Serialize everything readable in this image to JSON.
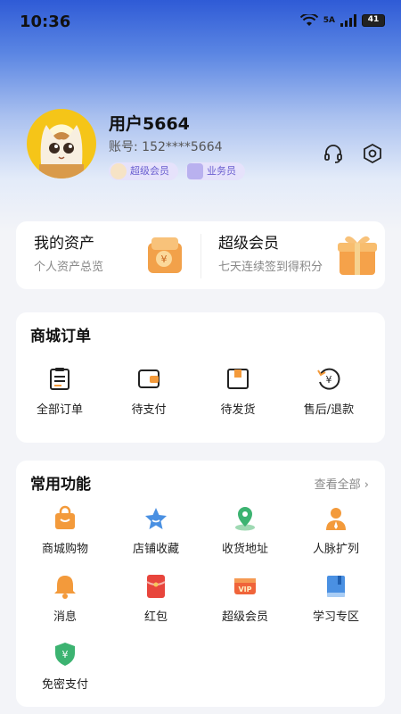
{
  "status_bar": {
    "time": "10:36",
    "signal_label": "5A",
    "battery": "41"
  },
  "profile": {
    "username": "用户5664",
    "account_label": "账号:",
    "account_number": "152****5664",
    "badges": [
      "超级会员",
      "业务员"
    ]
  },
  "assets": [
    {
      "title": "我的资产",
      "subtitle": "个人资产总览"
    },
    {
      "title": "超级会员",
      "subtitle": "七天连续签到得积分"
    }
  ],
  "orders": {
    "title": "商城订单",
    "items": [
      {
        "label": "全部订单",
        "icon": "clipboard-icon"
      },
      {
        "label": "待支付",
        "icon": "wallet-icon"
      },
      {
        "label": "待发货",
        "icon": "box-icon"
      },
      {
        "label": "售后/退款",
        "icon": "refund-icon"
      }
    ]
  },
  "functions": {
    "title": "常用功能",
    "see_all": "查看全部",
    "items": [
      {
        "label": "商城购物",
        "icon": "shopping-bag-icon"
      },
      {
        "label": "店铺收藏",
        "icon": "star-icon"
      },
      {
        "label": "收货地址",
        "icon": "location-icon"
      },
      {
        "label": "人脉扩列",
        "icon": "person-icon"
      },
      {
        "label": "消息",
        "icon": "bell-icon"
      },
      {
        "label": "红包",
        "icon": "red-envelope-icon"
      },
      {
        "label": "超级会员",
        "icon": "vip-icon"
      },
      {
        "label": "学习专区",
        "icon": "book-icon"
      },
      {
        "label": "免密支付",
        "icon": "shield-yuan-icon"
      }
    ]
  },
  "colors": {
    "brand_blue": "#2f5bd6",
    "badge_purple": "#6b5fd0",
    "orange": "#f39a3b"
  }
}
